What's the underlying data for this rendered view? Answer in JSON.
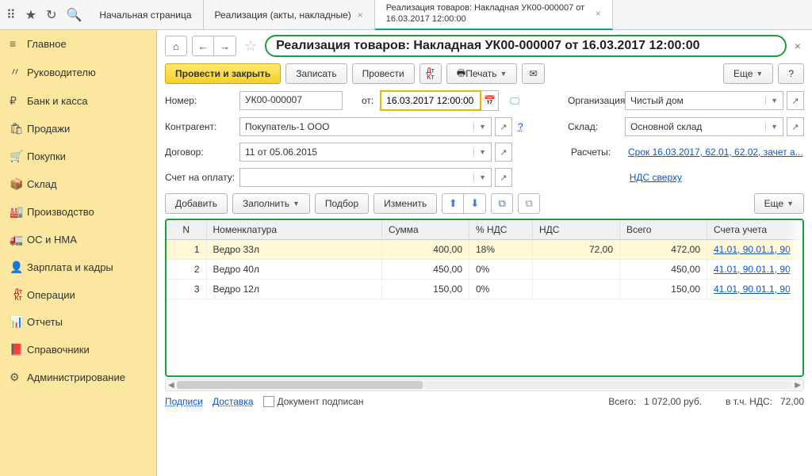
{
  "header": {
    "tabs": [
      {
        "label": "Начальная страница"
      },
      {
        "label": "Реализация (акты, накладные)"
      },
      {
        "label": "Реализация товаров: Накладная УК00-000007 от 16.03.2017 12:00:00"
      }
    ]
  },
  "sidebar": [
    {
      "icon": "≡",
      "label": "Главное"
    },
    {
      "icon": "📈",
      "label": "Руководителю"
    },
    {
      "icon": "₽",
      "label": "Банк и касса"
    },
    {
      "icon": "🛍",
      "label": "Продажи"
    },
    {
      "icon": "🛒",
      "label": "Покупки"
    },
    {
      "icon": "📦",
      "label": "Склад"
    },
    {
      "icon": "🏭",
      "label": "Производство"
    },
    {
      "icon": "🚚",
      "label": "ОС и НМА"
    },
    {
      "icon": "👤",
      "label": "Зарплата и кадры"
    },
    {
      "icon": "Дт",
      "label": "Операции"
    },
    {
      "icon": "📊",
      "label": "Отчеты"
    },
    {
      "icon": "📕",
      "label": "Справочники"
    },
    {
      "icon": "⚙",
      "label": "Администрирование"
    }
  ],
  "doc": {
    "title": "Реализация товаров: Накладная УК00-000007 от 16.03.2017 12:00:00",
    "save_close": "Провести и закрыть",
    "save": "Записать",
    "post": "Провести",
    "print": "Печать",
    "more": "Еще",
    "help": "?"
  },
  "form": {
    "number_label": "Номер:",
    "number_value": "УК00-000007",
    "date_label": "от:",
    "date_value": "16.03.2017 12:00:00",
    "org_label": "Организация:",
    "org_value": "Чистый дом",
    "counterparty_label": "Контрагент:",
    "counterparty_value": "Покупатель-1 ООО",
    "warehouse_label": "Склад:",
    "warehouse_value": "Основной склад",
    "contract_label": "Договор:",
    "contract_value": "11 от 05.06.2015",
    "calc_label": "Расчеты:",
    "calc_link": "Срок 16.03.2017, 62.01, 62.02, зачет а...",
    "invoice_label": "Счет на оплату:",
    "vat_link": "НДС сверху"
  },
  "toolbar": {
    "add": "Добавить",
    "fill": "Заполнить",
    "select": "Подбор",
    "change": "Изменить",
    "more": "Еще"
  },
  "table": {
    "headers": [
      "N",
      "Номенклатура",
      "Сумма",
      "% НДС",
      "НДС",
      "Всего",
      "Счета учета"
    ],
    "rows": [
      {
        "n": "1",
        "item": "Ведро 33л",
        "sum": "400,00",
        "vat_pct": "18%",
        "vat": "72,00",
        "total": "472,00",
        "accounts": "41.01, 90.01.1, 90"
      },
      {
        "n": "2",
        "item": "Ведро 40л",
        "sum": "450,00",
        "vat_pct": "0%",
        "vat": "",
        "total": "450,00",
        "accounts": "41.01, 90.01.1, 90"
      },
      {
        "n": "3",
        "item": "Ведро 12л",
        "sum": "150,00",
        "vat_pct": "0%",
        "vat": "",
        "total": "150,00",
        "accounts": "41.01, 90.01.1, 90"
      }
    ]
  },
  "footer": {
    "tabs": "Подписи    Доставка",
    "signed": "Документ подписан",
    "total_label": "Всего:",
    "total_value": "1 072,00",
    "currency": "руб.",
    "vat_label": "в т.ч. НДС:",
    "vat_value": "72,00"
  }
}
